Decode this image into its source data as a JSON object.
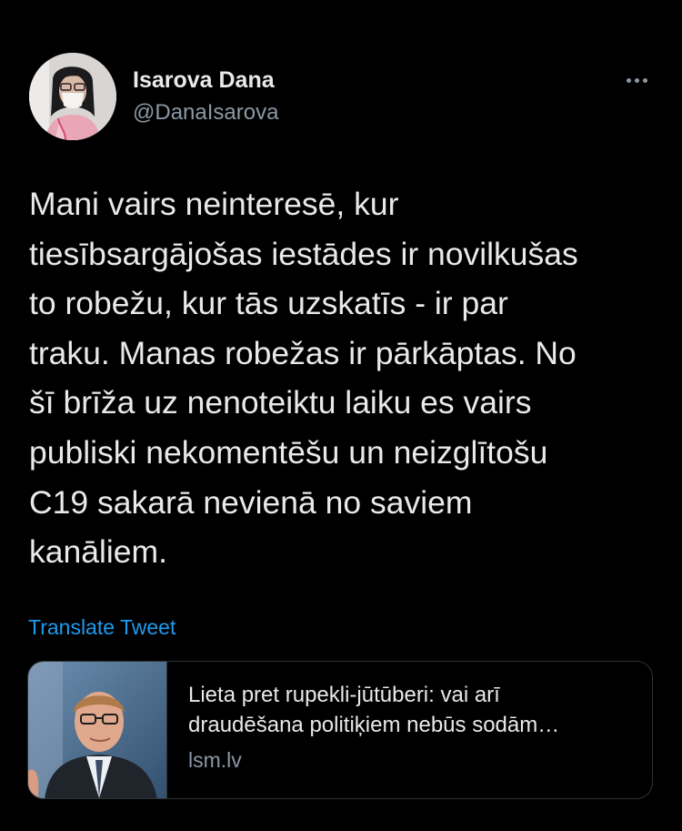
{
  "author": {
    "display_name": "Isarova Dana",
    "handle": "@DanaIsarova",
    "avatar_icon": "profile-photo"
  },
  "more_icon": "more-options-icon",
  "tweet": {
    "lines": [
      "Mani vairs neinteresē, kur",
      "tiesībsargājošas iestādes ir novilkušas",
      "to robežu, kur tās uzskatīs - ir par",
      "traku. Manas robežas ir pārkāptas. No",
      "šī brīža uz nenoteiktu laiku es vairs",
      "publiski nekomentēšu un neizglītošu",
      "C19 sakarā nevienā no saviem",
      "kanāliem."
    ]
  },
  "translate_label": "Translate Tweet",
  "card": {
    "title_lines": [
      "Lieta pret rupekli-jūtūberi: vai arī",
      "draudēšana politiķiem nebūs sodām…"
    ],
    "domain": "lsm.lv"
  },
  "colors": {
    "background": "#000000",
    "text": "#e7e9ea",
    "secondary": "#8b98a5",
    "link": "#1d9bf0",
    "border": "#2f3336"
  }
}
